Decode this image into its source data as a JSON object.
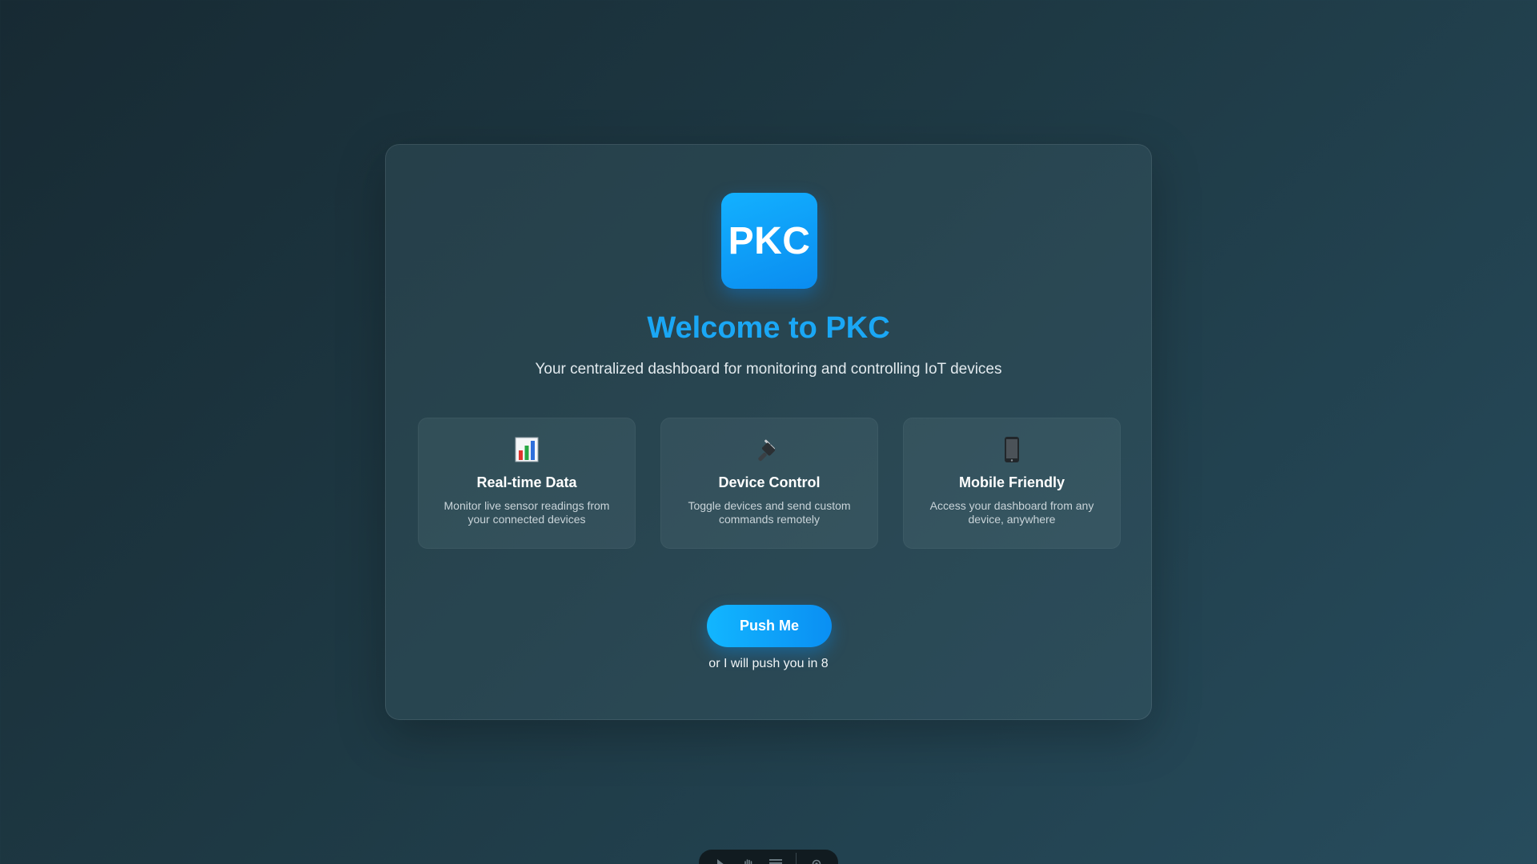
{
  "logo": {
    "text": "PKC",
    "color": "#13b1ff"
  },
  "welcome": {
    "title": "Welcome to PKC",
    "subtitle": "Your centralized dashboard for monitoring and controlling IoT devices"
  },
  "features": [
    {
      "icon": "bar-chart-icon",
      "title": "Real-time Data",
      "description": "Monitor live sensor readings from your connected devices"
    },
    {
      "icon": "plug-icon",
      "title": "Device Control",
      "description": "Toggle devices and send custom commands remotely"
    },
    {
      "icon": "mobile-phone-icon",
      "title": "Mobile Friendly",
      "description": "Access your dashboard from any device, anywhere"
    }
  ],
  "action": {
    "button_label": "Push Me",
    "countdown_text": "or I will push you in 8"
  },
  "dock": {
    "items": [
      "cursor-icon",
      "hand-icon",
      "menu-icon",
      "settings-icon"
    ]
  },
  "colors": {
    "accent": "#1aa7f5",
    "background": "#1e3944"
  }
}
